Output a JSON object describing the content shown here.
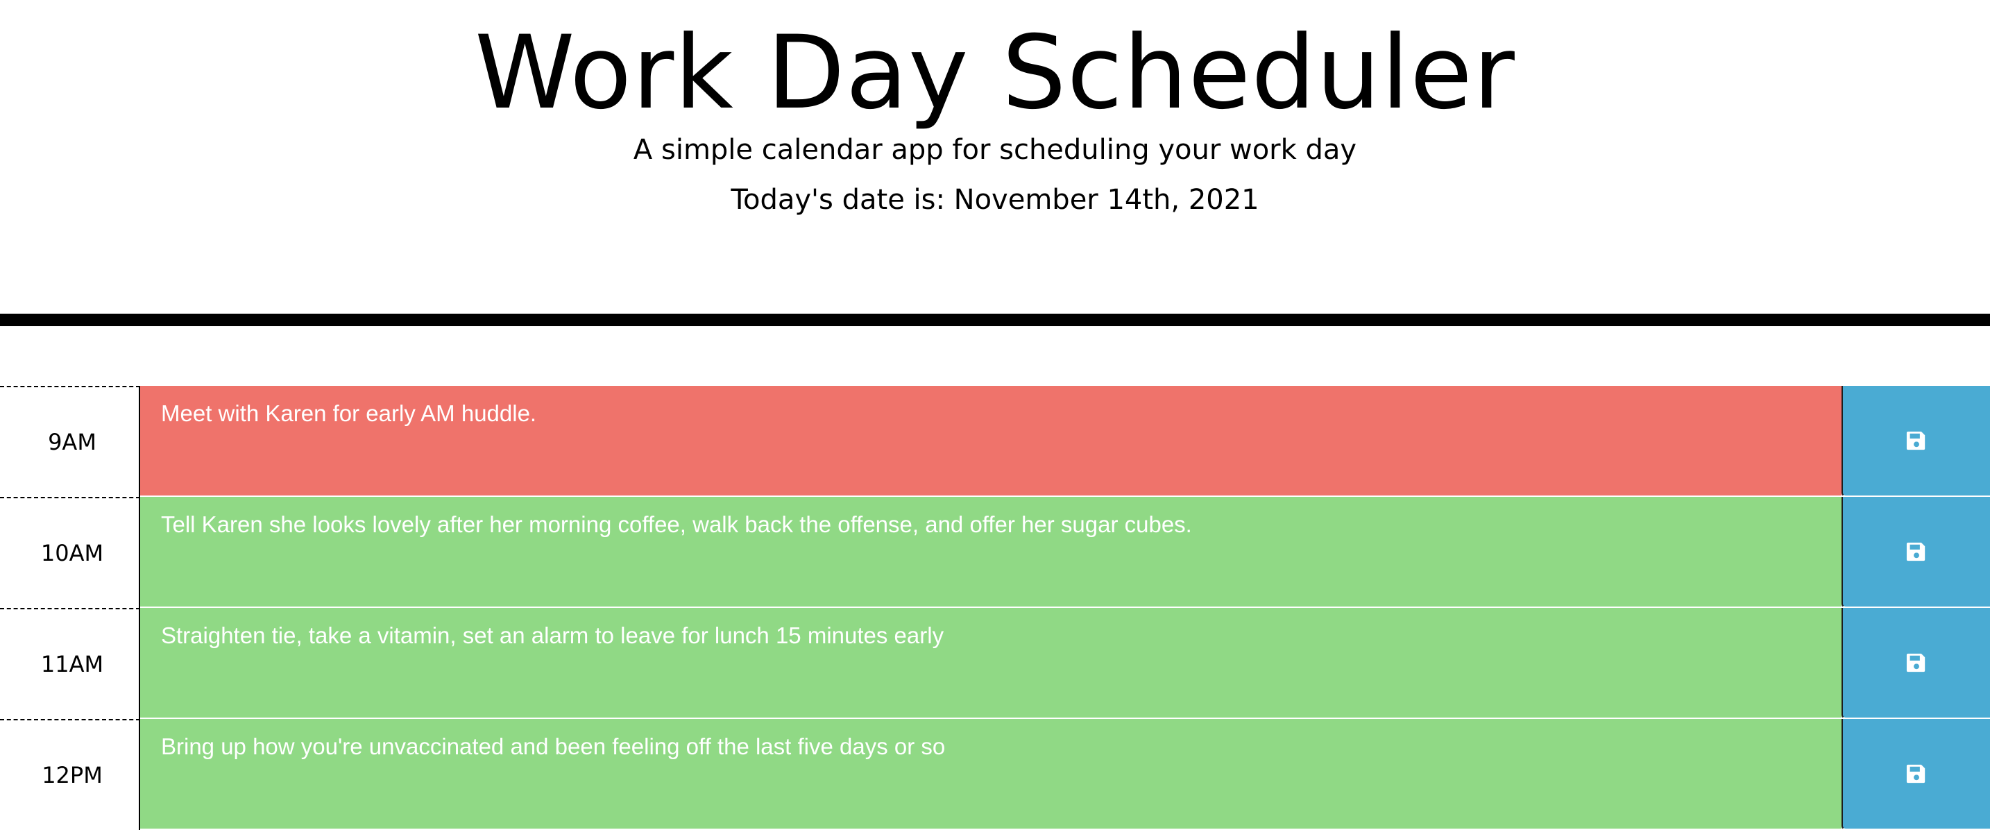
{
  "header": {
    "title": "Work Day Scheduler",
    "subtitle": "A simple calendar app for scheduling your work day",
    "current_day": "Today's date is: November 14th, 2021"
  },
  "colors": {
    "present": "#ef736b",
    "future": "#90d985",
    "save": "#4aabd3"
  },
  "time_blocks": [
    {
      "hour": "9AM",
      "text": "Meet with Karen for early AM huddle.",
      "status": "present"
    },
    {
      "hour": "10AM",
      "text": "Tell Karen she looks lovely after her morning coffee, walk back the offense, and offer her sugar cubes.",
      "status": "future"
    },
    {
      "hour": "11AM",
      "text": "Straighten tie, take a vitamin, set an alarm to leave for lunch 15 minutes early",
      "status": "future"
    },
    {
      "hour": "12PM",
      "text": "Bring up how you're unvaccinated and been feeling off the last five days or so",
      "status": "future"
    }
  ],
  "save_button": {
    "icon": "floppy-disk-icon"
  }
}
